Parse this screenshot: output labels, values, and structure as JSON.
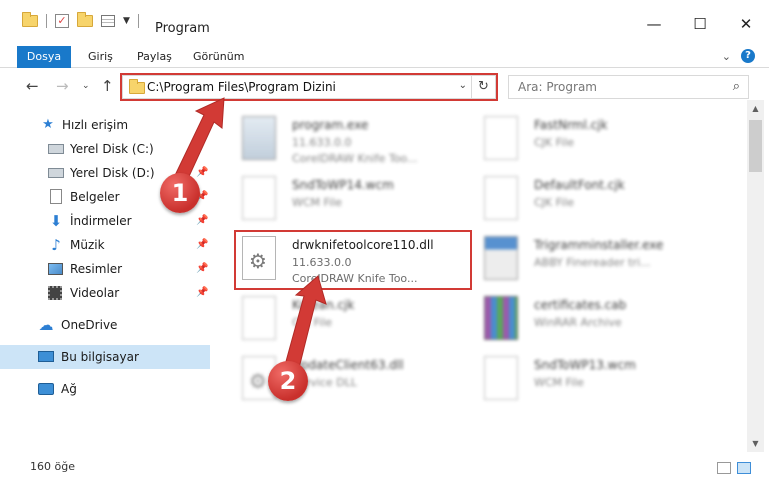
{
  "window": {
    "title": "Program",
    "controls": {
      "minimize": "—",
      "maximize": "☐",
      "close": "✕"
    }
  },
  "ribbon": {
    "tabs": [
      "Dosya",
      "Giriş",
      "Paylaş",
      "Görünüm"
    ],
    "help": "?"
  },
  "nav": {
    "address": "C:\\Program Files\\Program Dizini",
    "search_placeholder": "Ara: Program"
  },
  "sidebar": {
    "items": [
      {
        "label": "Hızlı erişim",
        "icon": "star-icon"
      },
      {
        "label": "Yerel Disk (C:)",
        "icon": "drive-icon"
      },
      {
        "label": "Yerel Disk (D:)",
        "icon": "drive-icon"
      },
      {
        "label": "Belgeler",
        "icon": "documents-icon"
      },
      {
        "label": "İndirmeler",
        "icon": "download-icon"
      },
      {
        "label": "Müzik",
        "icon": "music-icon"
      },
      {
        "label": "Resimler",
        "icon": "pictures-icon"
      },
      {
        "label": "Videolar",
        "icon": "videos-icon"
      },
      {
        "label": "OneDrive",
        "icon": "cloud-icon"
      },
      {
        "label": "Bu bilgisayar",
        "icon": "computer-icon",
        "selected": true
      },
      {
        "label": "Ağ",
        "icon": "network-icon"
      }
    ]
  },
  "files": [
    {
      "name": "program.exe",
      "line1": "11.633.0.0",
      "line2": "CorelDRAW Knife Too...",
      "icon": "exe-file-icon",
      "blurred": true
    },
    {
      "name": "FastNrml.cjk",
      "line1": "CJK File",
      "line2": "",
      "icon": "blank-file-icon",
      "blurred": true
    },
    {
      "name": "SndToWP14.wcm",
      "line1": "WCM File",
      "line2": "",
      "icon": "blank-file-icon",
      "blurred": true
    },
    {
      "name": "DefaultFont.cjk",
      "line1": "CJK File",
      "line2": "",
      "icon": "blank-file-icon",
      "blurred": true
    },
    {
      "name": "drwknifetoolcore110.dll",
      "line1": "11.633.0.0",
      "line2": "CorelDRAW Knife Too...",
      "icon": "dll-file-icon",
      "blurred": false
    },
    {
      "name": "Trigramminstaller.exe",
      "line1": "ABBY Finereader tri...",
      "line2": "",
      "icon": "installer-file-icon",
      "blurred": true
    },
    {
      "name": "Korean.cjk",
      "line1": "CJK File",
      "line2": "",
      "icon": "blank-file-icon",
      "blurred": true
    },
    {
      "name": "certificates.cab",
      "line1": "WinRAR Archive",
      "line2": "",
      "icon": "archive-file-icon",
      "blurred": true
    },
    {
      "name": "UpdateClient63.dll",
      "line1": "Service DLL",
      "line2": "",
      "icon": "dll-file-icon",
      "blurred": true
    },
    {
      "name": "SndToWP13.wcm",
      "line1": "WCM File",
      "line2": "",
      "icon": "blank-file-icon",
      "blurred": true
    }
  ],
  "status": {
    "count": "160 öğe"
  },
  "markers": {
    "first": "1",
    "second": "2"
  },
  "colors": {
    "accent": "#1979ca",
    "highlight": "#d23a35",
    "selection": "#cce4f7"
  }
}
